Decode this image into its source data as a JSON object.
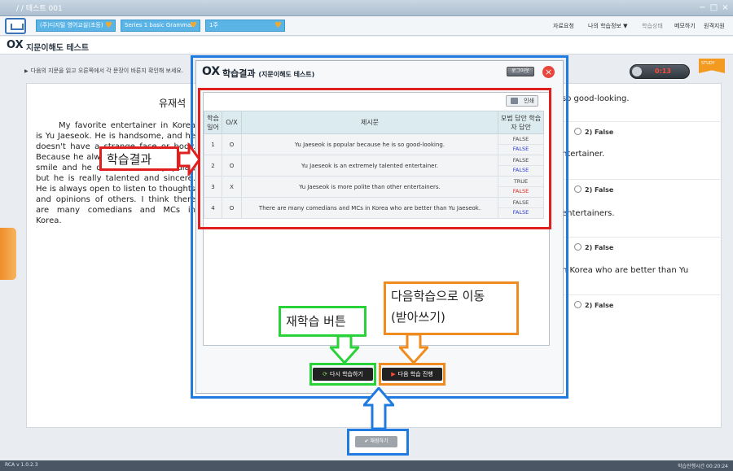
{
  "window": {
    "title": "/ / 테스트 001",
    "controls": [
      "−",
      "□",
      "×"
    ]
  },
  "menubar": {
    "selectors": [
      "(주)디지털 영어교실(초등)",
      "Series 1 basic Grammar",
      "1주"
    ],
    "links": [
      "자료요청",
      "나의 학습정보 ▼",
      "학습상태",
      "메모하기",
      "원격지원"
    ]
  },
  "subbar": {
    "ox": "OX",
    "title": "지문이해도 테스트"
  },
  "instructions": "다음의 지문을 읽고 오른쪽에서 각 문장이 바른지 확인해 보세요.",
  "toggle": {
    "label": "0:13"
  },
  "badge": {
    "label": "STUDY"
  },
  "passage": {
    "title": "유재석",
    "text": "My favorite entertainer in Korea is Yu Jaeseok. He is handsome, and he doesn't have a strange face or body. Because he always shows his pleasant smile and he don't seem so popular, but he is really talented and sincere. He is always open to listen to thoughts and opinions of others. I think there are many comedians and MCs in Korea."
  },
  "questions": [
    {
      "text": "so good-looking.",
      "option": "2) False"
    },
    {
      "text": "ntertainer.",
      "option": "2) False"
    },
    {
      "text": "entertainers.",
      "option": "2) False"
    },
    {
      "text": "n Korea who are better than Yu",
      "option": "2) False"
    }
  ],
  "modal": {
    "ox": "OX",
    "title": "학습결과",
    "subtitle": "(지문이해도 테스트)",
    "mini_button": "로그아웃",
    "close": "×",
    "print_button": "인쇄",
    "table": {
      "headers": [
        "학습 일어",
        "O/X",
        "제시문",
        "모범 답안 학습자 답안"
      ],
      "rows": [
        {
          "no": "1",
          "ox": "O",
          "statement": "Yu Jaeseok is popular because he is so good-looking.",
          "model": "FALSE",
          "user": "FALSE",
          "correct": true
        },
        {
          "no": "2",
          "ox": "O",
          "statement": "Yu Jaeseok is an extremely talented entertainer.",
          "model": "FALSE",
          "user": "FALSE",
          "correct": true
        },
        {
          "no": "3",
          "ox": "X",
          "statement": "Yu Jaeseok is more polite than other entertainers.",
          "model": "TRUE",
          "user": "FALSE",
          "correct": false
        },
        {
          "no": "4",
          "ox": "O",
          "statement": "There are many comedians and MCs in Korea who are better than Yu Jaeseok.",
          "model": "FALSE",
          "user": "FALSE",
          "correct": true
        }
      ]
    },
    "retry_button": "다시 학습하기",
    "next_button": "다음 학습 진행"
  },
  "submit_button": "채점하기",
  "callouts": {
    "result": "학습결과",
    "retry": "재학습 버튼",
    "next_line1": "다음학습으로 이동",
    "next_line2": "(받아쓰기)"
  },
  "status": {
    "left": "RCA v 1.0.2.3",
    "right": "학습진행시간 00:20:24"
  },
  "colors": {
    "red_highlight": "#e01f1f",
    "blue_highlight": "#1f7be0",
    "green_highlight": "#2ad23a",
    "orange_highlight": "#f08c1f"
  }
}
